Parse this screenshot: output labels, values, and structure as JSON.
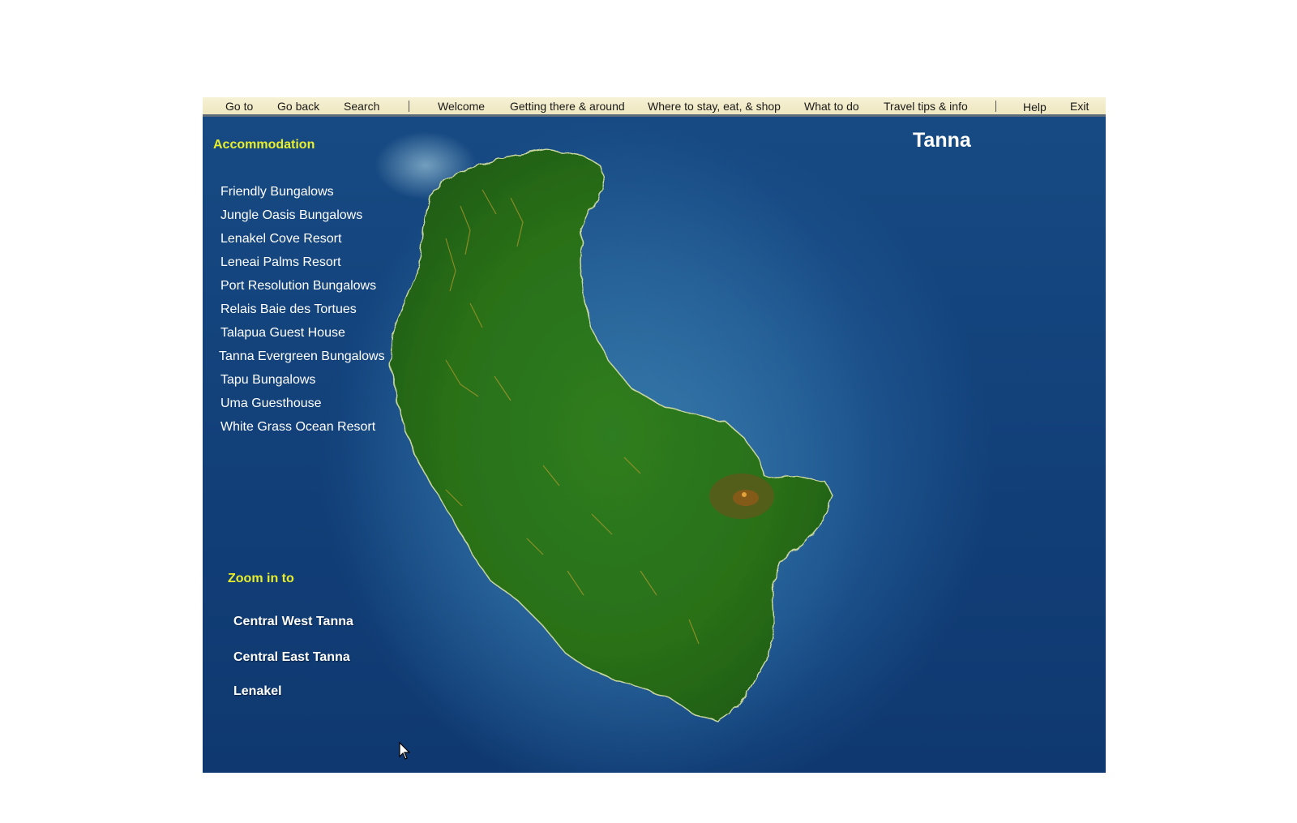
{
  "menubar": {
    "goto": "Go to",
    "goback": "Go back",
    "search": "Search",
    "welcome": "Welcome",
    "getting_there": "Getting there & around",
    "where_to_stay": "Where to stay, eat, & shop",
    "what_to_do": "What to do",
    "travel_tips": "Travel tips & info",
    "help": "Help",
    "exit": "Exit"
  },
  "map": {
    "title": "Tanna",
    "accommodation_heading": "Accommodation",
    "accommodation": [
      "Friendly Bungalows",
      "Jungle Oasis Bungalows",
      "Lenakel Cove Resort",
      "Leneai Palms Resort",
      "Port Resolution Bungalows",
      "Relais Baie des Tortues",
      "Talapua Guest House",
      "Tanna Evergreen Bungalows",
      "Tapu Bungalows",
      "Uma Guesthouse",
      "White Grass Ocean Resort"
    ],
    "zoom_heading": "Zoom in to",
    "zoom": [
      "Central West Tanna",
      "Central East Tanna",
      "Lenakel"
    ]
  },
  "colors": {
    "heading": "#e8ee2a",
    "ocean": "#174a83",
    "land": "#2f7a1f",
    "menubar": "#f2ecc9"
  }
}
